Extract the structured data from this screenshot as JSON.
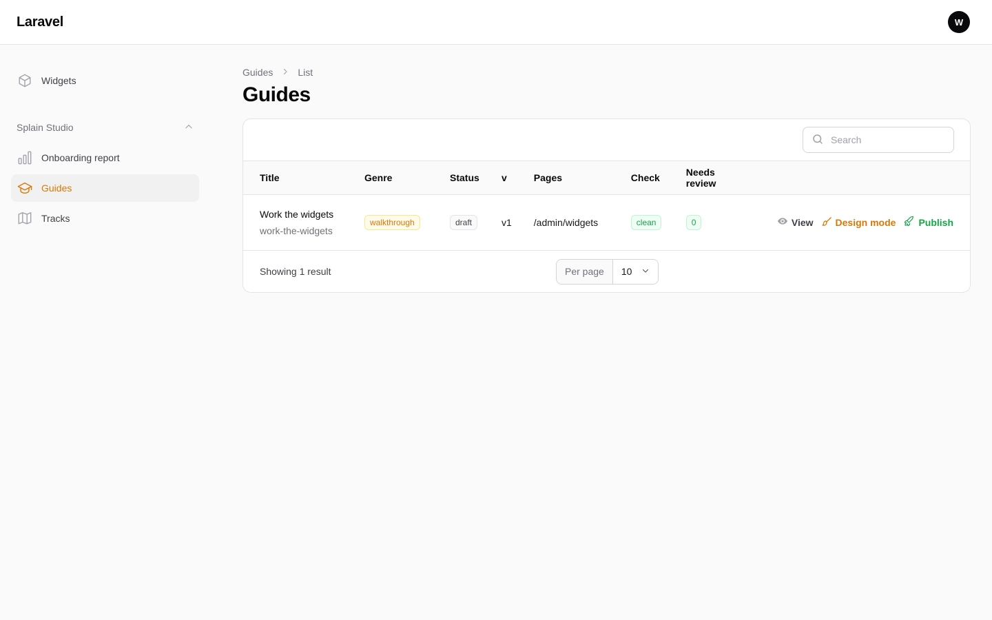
{
  "app": {
    "brand": "Laravel",
    "avatar_initial": "W"
  },
  "sidebar": {
    "top_items": [
      {
        "label": "Widgets",
        "icon": "cube-icon"
      }
    ],
    "group": {
      "label": "Splain Studio",
      "items": [
        {
          "label": "Onboarding report",
          "icon": "bar-chart-icon"
        },
        {
          "label": "Guides",
          "icon": "graduation-cap-icon",
          "active": true
        },
        {
          "label": "Tracks",
          "icon": "map-icon"
        }
      ]
    }
  },
  "breadcrumb": {
    "parent": "Guides",
    "current": "List"
  },
  "page": {
    "title": "Guides"
  },
  "search": {
    "placeholder": "Search"
  },
  "table": {
    "columns": [
      "Title",
      "Genre",
      "Status",
      "v",
      "Pages",
      "Check",
      "Needs review"
    ],
    "rows": [
      {
        "title": "Work the widgets",
        "slug": "work-the-widgets",
        "genre": "walkthrough",
        "status": "draft",
        "version": "v1",
        "pages": "/admin/widgets",
        "check": "clean",
        "needs_review": "0",
        "actions": {
          "view": "View",
          "design": "Design mode",
          "publish": "Publish"
        }
      }
    ]
  },
  "footer": {
    "summary": "Showing 1 result",
    "per_page_label": "Per page",
    "per_page_value": "10"
  },
  "colors": {
    "accent": "#d97706",
    "success": "#16a34a",
    "text": "#09090b",
    "muted": "#71717a"
  }
}
